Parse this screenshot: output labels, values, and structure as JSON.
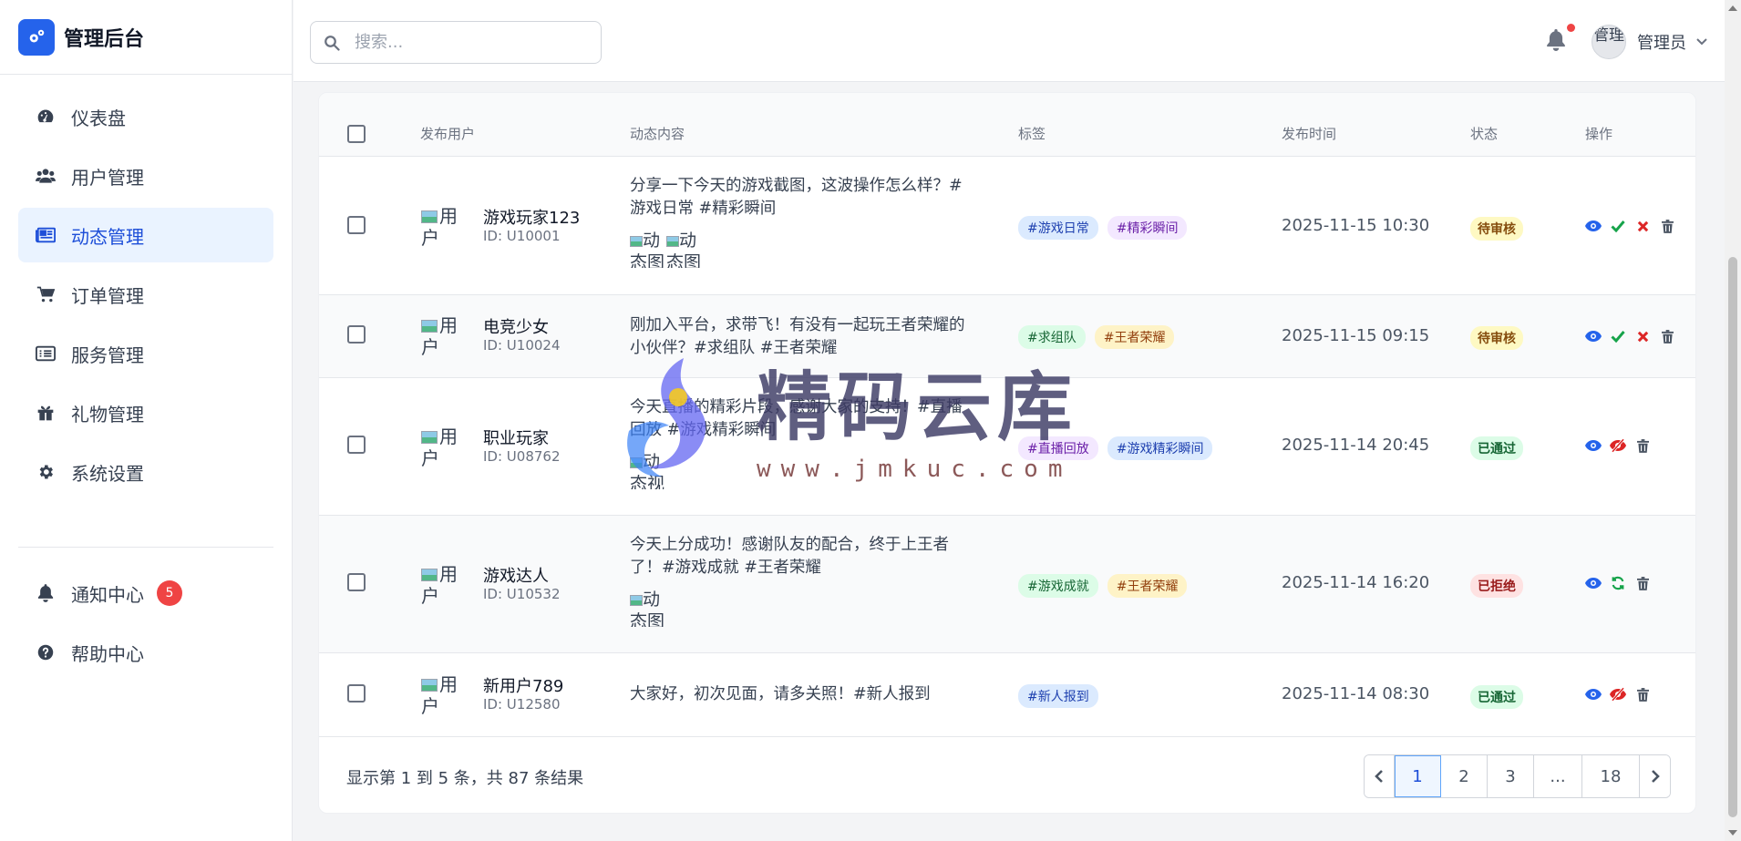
{
  "brand": {
    "title": "管理后台",
    "logo_icon": "cogs-icon"
  },
  "sidebar": {
    "items": [
      {
        "label": "仪表盘",
        "icon": "dashboard-icon"
      },
      {
        "label": "用户管理",
        "icon": "users-icon"
      },
      {
        "label": "动态管理",
        "icon": "newspaper-icon",
        "active": true
      },
      {
        "label": "订单管理",
        "icon": "cart-icon"
      },
      {
        "label": "服务管理",
        "icon": "list-icon"
      },
      {
        "label": "礼物管理",
        "icon": "gift-icon"
      },
      {
        "label": "系统设置",
        "icon": "gear-icon"
      }
    ],
    "bottom_items": [
      {
        "label": "通知中心",
        "icon": "bell-icon",
        "badge": "5"
      },
      {
        "label": "帮助中心",
        "icon": "question-circle-icon"
      }
    ]
  },
  "search": {
    "placeholder": "搜索...",
    "value": ""
  },
  "user": {
    "avatar_alt": "管理",
    "name": "管理员"
  },
  "table": {
    "headers": [
      "发布用户",
      "动态内容",
      "标签",
      "发布时间",
      "状态",
      "操作"
    ],
    "rows": [
      {
        "avatar_alt": "用户",
        "name": "游戏玩家123",
        "id": "ID: U10001",
        "content": "分享一下今天的游戏截图，这波操作怎么样？#游戏日常 #精彩瞬间",
        "images": [
          "动态图",
          "动态图"
        ],
        "tags": [
          "#游戏日常",
          "#精彩瞬间"
        ],
        "time": "2025-11-15 10:30",
        "status": "待审核"
      },
      {
        "avatar_alt": "用户",
        "name": "电竞少女",
        "id": "ID: U10024",
        "content": "刚加入平台，求带飞！有没有一起玩王者荣耀的小伙伴？#求组队 #王者荣耀",
        "images": [],
        "tags": [
          "#求组队",
          "#王者荣耀"
        ],
        "time": "2025-11-15 09:15",
        "status": "待审核"
      },
      {
        "avatar_alt": "用户",
        "name": "职业玩家",
        "id": "ID: U08762",
        "content": "今天直播的精彩片段，感谢大家的支持！#直播回放 #游戏精彩瞬间",
        "images": [
          "动态视"
        ],
        "tags": [
          "#直播回放",
          "#游戏精彩瞬间"
        ],
        "time": "2025-11-14 20:45",
        "status": "已通过"
      },
      {
        "avatar_alt": "用户",
        "name": "游戏达人",
        "id": "ID: U10532",
        "content": "今天上分成功！感谢队友的配合，终于上王者了！#游戏成就 #王者荣耀",
        "images": [
          "动态图"
        ],
        "tags": [
          "#游戏成就",
          "#王者荣耀"
        ],
        "time": "2025-11-14 16:20",
        "status": "已拒绝"
      },
      {
        "avatar_alt": "用户",
        "name": "新用户789",
        "id": "ID: U12580",
        "content": "大家好，初次见面，请多关照！#新人报到",
        "images": [],
        "tags": [
          "#新人报到"
        ],
        "time": "2025-11-14 08:30",
        "status": "已通过"
      }
    ]
  },
  "footer": {
    "summary": "显示第 1 到 5 条，共 87 条结果"
  },
  "pagination": {
    "pages": [
      "1",
      "2",
      "3",
      "...",
      "18"
    ],
    "current": "1"
  },
  "watermark": {
    "text": "精码云库",
    "url": "www.jmkuc.com"
  },
  "colors": {
    "accent": "#2563eb",
    "badge": "#ef4444",
    "active_bg": "#eaf3ff"
  }
}
